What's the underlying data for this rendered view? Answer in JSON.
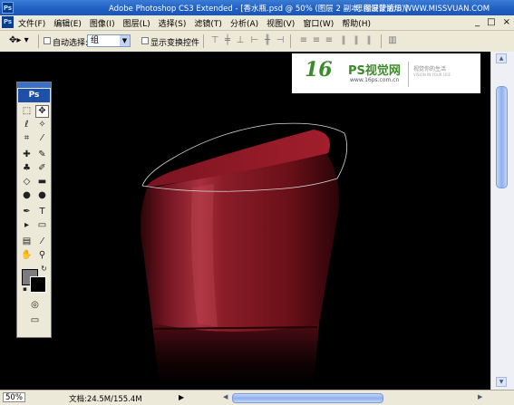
{
  "window": {
    "title": "Adobe Photoshop CS3 Extended - [香水瓶.psd @ 50% (图层 2 副本, 图层蒙版/8)]",
    "watermark": "思缘设计论坛 WWW.MISSVUAN.COM",
    "app_icon": "Ps",
    "controls": {
      "minimize": "_",
      "maximize": "□",
      "close": "×"
    }
  },
  "menu": {
    "ps_icon": "Ps",
    "items": [
      "文件(F)",
      "编辑(E)",
      "图像(I)",
      "图层(L)",
      "选择(S)",
      "滤镜(T)",
      "分析(A)",
      "视图(V)",
      "窗口(W)",
      "帮助(H)"
    ],
    "right_controls": [
      "_",
      "□",
      "×"
    ]
  },
  "options": {
    "auto_select_label": "自动选择:",
    "auto_select_value": "组",
    "show_transform_label": "显示变换控件"
  },
  "toolbox": {
    "logo": "Ps"
  },
  "canvas_logo": {
    "number": "16",
    "name": "PS视觉网",
    "url": "www.16ps.com.cn",
    "slogan_cn": "视觉你的生活",
    "slogan_en": "VISION IN YOUR LIFE"
  },
  "status": {
    "zoom": "50%",
    "doc_info": "文档:24.5M/155.4M"
  },
  "colors": {
    "bottle": "#8e1b26",
    "bottle_dark": "#3d0810",
    "titlebar": "#2563c9",
    "chrome": "#ece9d8"
  }
}
